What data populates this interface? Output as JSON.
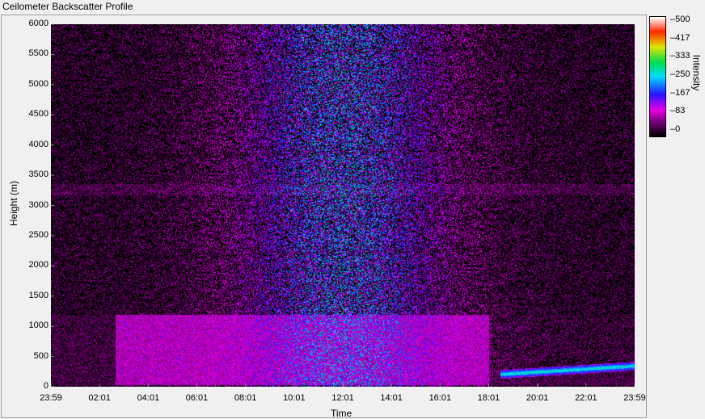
{
  "window": {
    "title": "Ceilometer Backscatter Profile"
  },
  "chart_data": {
    "type": "heatmap",
    "title": "Ceilometer Backscatter Profile",
    "xlabel": "Time",
    "ylabel": "Height (m)",
    "x_ticks": [
      "23:59",
      "02:01",
      "04:01",
      "06:01",
      "08:01",
      "10:01",
      "12:01",
      "14:01",
      "16:01",
      "18:01",
      "20:01",
      "22:01",
      "23:59"
    ],
    "y_ticks": [
      "0",
      "500",
      "1000",
      "1500",
      "2000",
      "2500",
      "3000",
      "3500",
      "4000",
      "4500",
      "5000",
      "5500",
      "6000"
    ],
    "ylim": [
      0,
      6000
    ],
    "colorbar": {
      "label": "Intensity",
      "ticks": [
        "500",
        "417",
        "333",
        "250",
        "167",
        "83",
        "0"
      ],
      "range": [
        0,
        500
      ]
    }
  }
}
